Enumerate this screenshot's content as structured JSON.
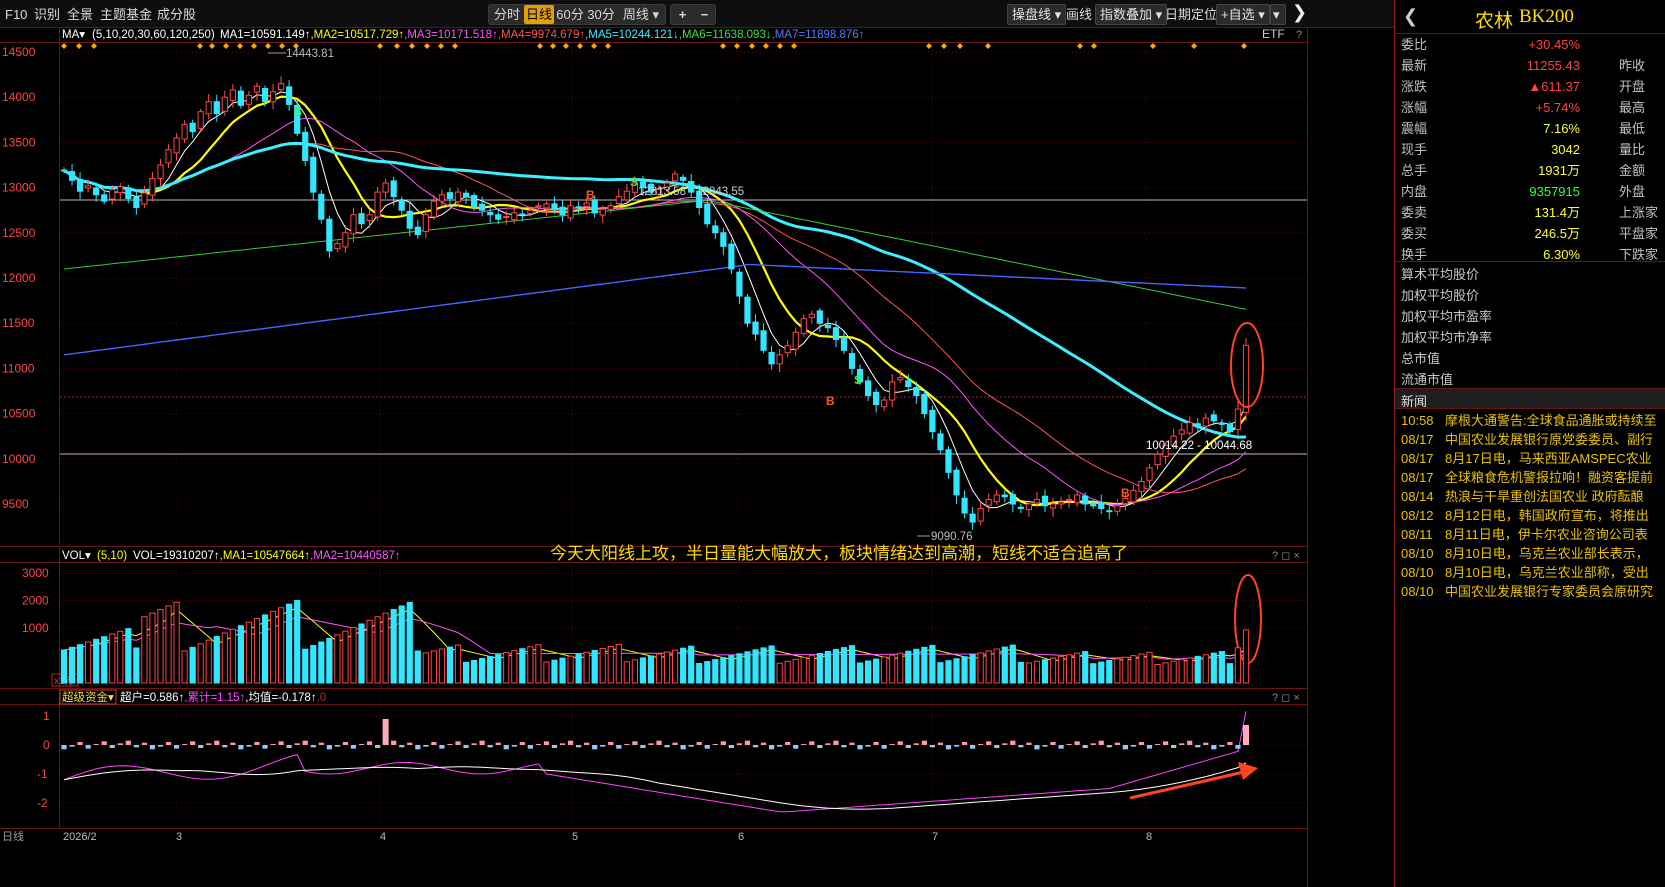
{
  "toolbar": {
    "f10": "F10",
    "recognize": "识别",
    "overview": "全景",
    "theme_fund": "主题基金",
    "components": "成分股",
    "periods": [
      "分时",
      "日线",
      "60分",
      "30分",
      "周线"
    ],
    "active_period": "日线",
    "plus": "+",
    "minus": "−",
    "draw_line": "操盘线",
    "draw": "画线",
    "index_overlay": "指数叠加",
    "date_locate": "日期定位",
    "add_watch": "+自选",
    "close": "×"
  },
  "main_chart": {
    "ma_header": {
      "name": "MA",
      "params": "(5,10,20,30,60,120,250)",
      "items": [
        {
          "text": "MA1=10591.149↑",
          "color": "#ffffff"
        },
        {
          "text": "MA2=10517.729↑",
          "color": "#ffff00"
        },
        {
          "text": "MA3=10171.518↑",
          "color": "#ff55ff"
        },
        {
          "text": "MA4=9974.679↑",
          "color": "#ff5555"
        },
        {
          "text": "MA5=10244.121↓",
          "color": "#3cf0ff"
        },
        {
          "text": "MA6=11638.093↓",
          "color": "#44dd44"
        },
        {
          "text": "MA7=11898.876↑",
          "color": "#5577ff"
        }
      ],
      "etf": "ETF",
      "help": "?"
    },
    "y_ticks": [
      "14500",
      "14000",
      "13500",
      "13000",
      "12500",
      "12000",
      "11500",
      "11000",
      "10500",
      "10000",
      "9500"
    ],
    "annotations": {
      "high": "14443.81",
      "low": "9090.76",
      "range1": "12813.58 - 12843.55",
      "range2": "10014.22 - 10044.68"
    },
    "overlay_text": "今天大阳线上攻，半日量能大幅放大，板块情绪达到高潮，短线不适合追高了",
    "signals": {
      "buy": "B",
      "sell": "S"
    }
  },
  "volume_chart": {
    "name": "VOL",
    "params": "(5,10)",
    "items": [
      {
        "text": "VOL=19310207↑",
        "color": "#ffffff"
      },
      {
        "text": "MA1=10547664↑",
        "color": "#ffff00"
      },
      {
        "text": "MA2=10440587↑",
        "color": "#ff55ff"
      }
    ],
    "y_ticks": [
      "3000",
      "2000",
      "1000"
    ],
    "unit": "x1万"
  },
  "fund_chart": {
    "name": "超级资金",
    "items": [
      {
        "text": "超户=0.586↑",
        "color": "#ffffff"
      },
      {
        "text": "累计=1.15↑",
        "color": "#ff44ff"
      },
      {
        "text": "均值=-0.178↑",
        "color": "#ffffff"
      },
      {
        "text": "0",
        "color": "#aa3333"
      }
    ],
    "y_ticks": [
      "1",
      "0",
      "-1",
      "-2"
    ]
  },
  "x_axis": {
    "period_label": "日线",
    "labels": [
      "2026/2",
      "3",
      "4",
      "5",
      "6",
      "7",
      "8"
    ]
  },
  "quote": {
    "name": "农林",
    "code": "BK200",
    "rows": [
      {
        "label": "委比",
        "value": "+30.45%",
        "color": "#ff4444",
        "label2": ""
      },
      {
        "label": "最新",
        "value": "11255.43",
        "color": "#ff4444",
        "label2": "昨收"
      },
      {
        "label": "涨跌",
        "value": "▲611.37",
        "color": "#ff4444",
        "label2": "开盘"
      },
      {
        "label": "涨幅",
        "value": "+5.74%",
        "color": "#ff4444",
        "label2": "最高"
      },
      {
        "label": "震幅",
        "value": "7.16%",
        "color": "#ffff33",
        "label2": "最低"
      },
      {
        "label": "现手",
        "value": "3042",
        "color": "#ffff33",
        "label2": "量比"
      },
      {
        "label": "总手",
        "value": "1931万",
        "color": "#ffff33",
        "label2": "金额"
      },
      {
        "label": "内盘",
        "value": "9357915",
        "color": "#33ff33",
        "label2": "外盘"
      },
      {
        "label": "委卖",
        "value": "131.4万",
        "color": "#ffff33",
        "label2": "上涨家"
      },
      {
        "label": "委买",
        "value": "246.5万",
        "color": "#ffff33",
        "label2": "平盘家"
      },
      {
        "label": "换手",
        "value": "6.30%",
        "color": "#ffff33",
        "label2": "下跌家"
      }
    ],
    "info": [
      "算术平均股价",
      "加权平均股价",
      "加权平均市盈率",
      "加权平均市净率",
      "总市值",
      "流通市值"
    ]
  },
  "news": {
    "header": "新闻",
    "items": [
      {
        "time": "10:58",
        "title": "摩根大通警告:全球食品通胀或持续至"
      },
      {
        "time": "08/17",
        "title": "中国农业发展银行原党委委员、副行"
      },
      {
        "time": "08/17",
        "title": "8月17日电，马来西亚AMSPEC农业"
      },
      {
        "time": "08/17",
        "title": "全球粮食危机警报拉响！融资客提前"
      },
      {
        "time": "08/14",
        "title": "热浪与干旱重创法国农业 政府酝酿"
      },
      {
        "time": "08/12",
        "title": "8月12日电，韩国政府宣布，将推出"
      },
      {
        "time": "08/11",
        "title": "8月11日电，伊卡尔农业咨询公司表"
      },
      {
        "time": "08/10",
        "title": "8月10日电，乌克兰农业部长表示，"
      },
      {
        "time": "08/10",
        "title": "8月10日电，乌克兰农业部称，受出"
      },
      {
        "time": "08/10",
        "title": "中国农业发展银行专家委员会原研究"
      }
    ]
  },
  "colors": {
    "up": "#ff4444",
    "down": "#33e6ff",
    "accent": "#e0a000",
    "annotation": "#ff4422"
  }
}
